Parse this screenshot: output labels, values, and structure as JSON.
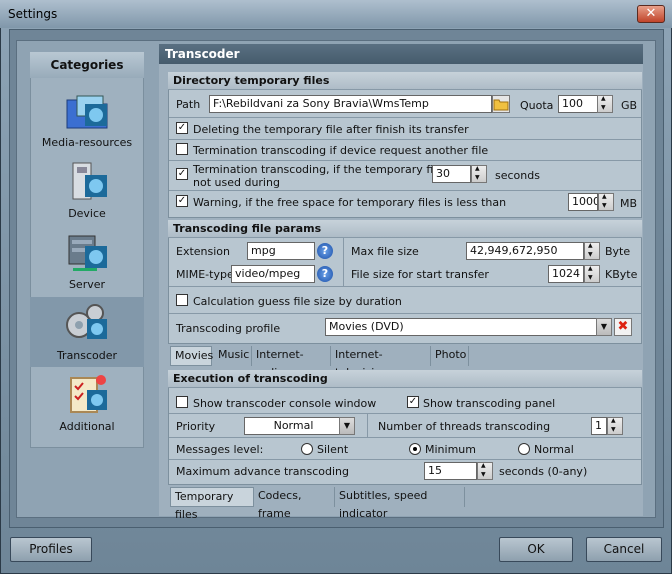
{
  "window": {
    "title": "Settings",
    "close": "✕"
  },
  "categories": {
    "title": "Categories",
    "items": [
      {
        "label": "Media-resources"
      },
      {
        "label": "Device"
      },
      {
        "label": "Server"
      },
      {
        "label": "Transcoder"
      },
      {
        "label": "Additional"
      }
    ]
  },
  "panel_title": "Transcoder",
  "dir": {
    "title": "Directory temporary files",
    "path_label": "Path",
    "path_value": "F:\\Rebildvani za Sony Bravia\\WmsTemp",
    "quota_label": "Quota",
    "quota_value": "100",
    "quota_unit": "GB",
    "opt1": "Deleting the temporary file after finish its transfer",
    "opt2": "Termination transcoding if device request another file",
    "opt3_line1": "Termination transcoding, if the temporary file is",
    "opt3_line2": "not used during",
    "opt3_value": "30",
    "opt3_unit": "seconds",
    "opt4": "Warning, if the free space for temporary files is less than",
    "opt4_value": "1000",
    "opt4_unit": "MB"
  },
  "params": {
    "title": "Transcoding file params",
    "ext_label": "Extension",
    "ext_value": "mpg",
    "mime_label": "MIME-type",
    "mime_value": "video/mpeg",
    "max_label": "Max file size",
    "max_value": "42,949,672,950",
    "max_unit": "Byte",
    "start_label": "File size for start transfer",
    "start_value": "1024",
    "start_unit": "KByte",
    "calc_label": "Calculation guess file size by duration",
    "profile_label": "Transcoding profile",
    "profile_value": "Movies (DVD)"
  },
  "media_tabs": [
    "Movies",
    "Music",
    "Internet-radio",
    "Internet-television",
    "Photo"
  ],
  "exec": {
    "title": "Execution of transcoding",
    "console": "Show transcoder console window",
    "panel": "Show transcoding panel",
    "priority_label": "Priority",
    "priority_value": "Normal",
    "threads_label": "Number of threads transcoding",
    "threads_value": "1",
    "msg_label": "Messages level:",
    "msg_opts": [
      "Silent",
      "Minimum",
      "Normal"
    ],
    "adv_label": "Maximum advance transcoding",
    "adv_value": "15",
    "adv_unit": "seconds (0-any)"
  },
  "bottom_tabs": [
    "Temporary files",
    "Codecs, frame",
    "Subtitles, speed indicator"
  ],
  "buttons": {
    "profiles": "Profiles",
    "ok": "OK",
    "cancel": "Cancel"
  }
}
